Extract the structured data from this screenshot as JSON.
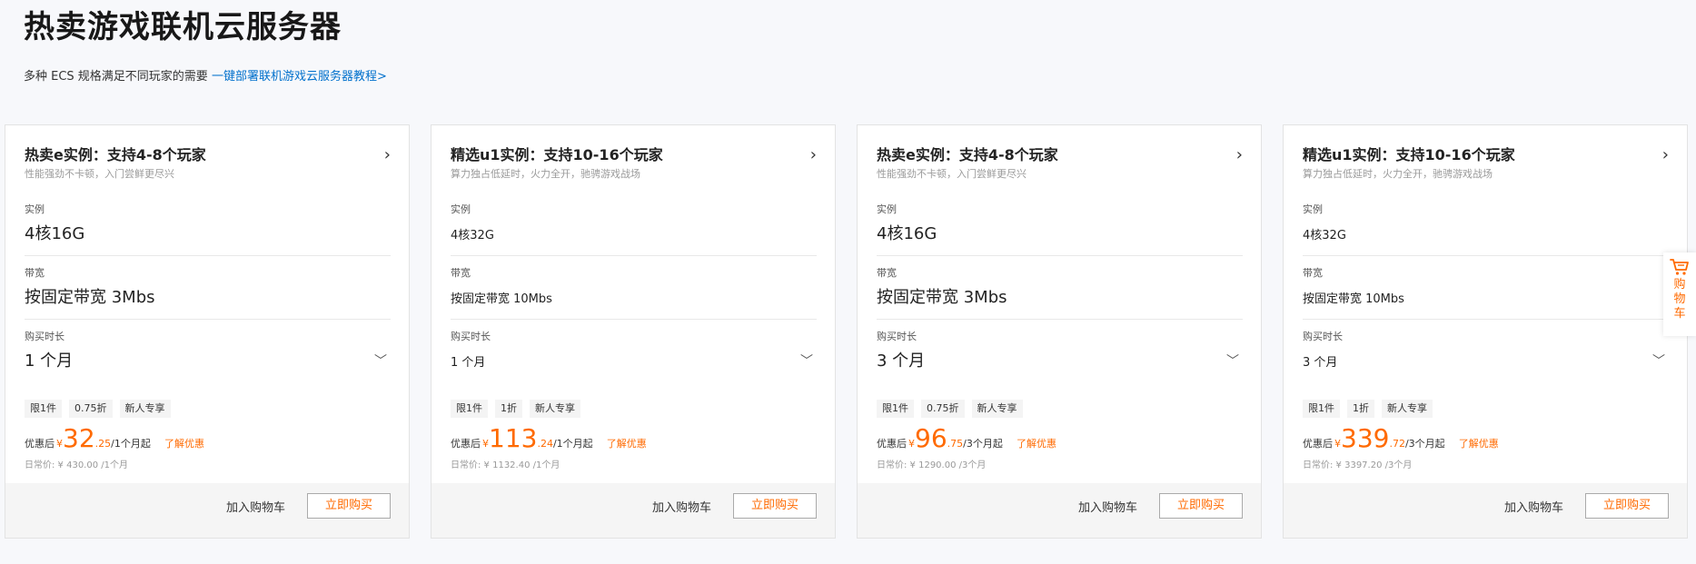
{
  "page": {
    "title": "热卖游戏联机云服务器",
    "subtitle": "多种 ECS 规格满足不同玩家的需要",
    "subtitle_link": "一键部署联机游戏云服务器教程>"
  },
  "labels": {
    "instance": "实例",
    "bandwidth": "带宽",
    "duration": "购买时长",
    "price_prefix": "优惠后",
    "currency": "¥",
    "promo_link": "了解优惠",
    "add_cart": "加入购物车",
    "buy_now": "立即购买"
  },
  "cards": [
    {
      "title": "热卖e实例：支持4-8个玩家",
      "desc": "性能强劲不卡顿，入门尝鲜更尽兴",
      "instance": "4核16G",
      "bandwidth": "按固定带宽 3Mbs",
      "duration": "1 个月",
      "tags": [
        "限1件",
        "0.75折",
        "新人专享"
      ],
      "price_int": "32",
      "price_dec": ".25",
      "price_unit": "/1个月起",
      "orig": "日常价: ¥ 430.00 /1个月"
    },
    {
      "title": "精选u1实例：支持10-16个玩家",
      "desc": "算力独占低延时，火力全开，驰骋游戏战场",
      "instance": "4核32G",
      "bandwidth": "按固定带宽 10Mbs",
      "duration": "1 个月",
      "tags": [
        "限1件",
        "1折",
        "新人专享"
      ],
      "price_int": "113",
      "price_dec": ".24",
      "price_unit": "/1个月起",
      "orig": "日常价: ¥ 1132.40 /1个月"
    },
    {
      "title": "热卖e实例：支持4-8个玩家",
      "desc": "性能强劲不卡顿，入门尝鲜更尽兴",
      "instance": "4核16G",
      "bandwidth": "按固定带宽 3Mbs",
      "duration": "3 个月",
      "tags": [
        "限1件",
        "0.75折",
        "新人专享"
      ],
      "price_int": "96",
      "price_dec": ".75",
      "price_unit": "/3个月起",
      "orig": "日常价: ¥ 1290.00 /3个月"
    },
    {
      "title": "精选u1实例：支持10-16个玩家",
      "desc": "算力独占低延时，火力全开，驰骋游戏战场",
      "instance": "4核32G",
      "bandwidth": "按固定带宽 10Mbs",
      "duration": "3 个月",
      "tags": [
        "限1件",
        "1折",
        "新人专享"
      ],
      "price_int": "339",
      "price_dec": ".72",
      "price_unit": "/3个月起",
      "orig": "日常价: ¥ 3397.20 /3个月"
    }
  ],
  "float_cart": {
    "icon": "shopping-cart-icon",
    "label": "购物车"
  },
  "colors": {
    "accent": "#ff6a00",
    "link": "#0070cc"
  }
}
